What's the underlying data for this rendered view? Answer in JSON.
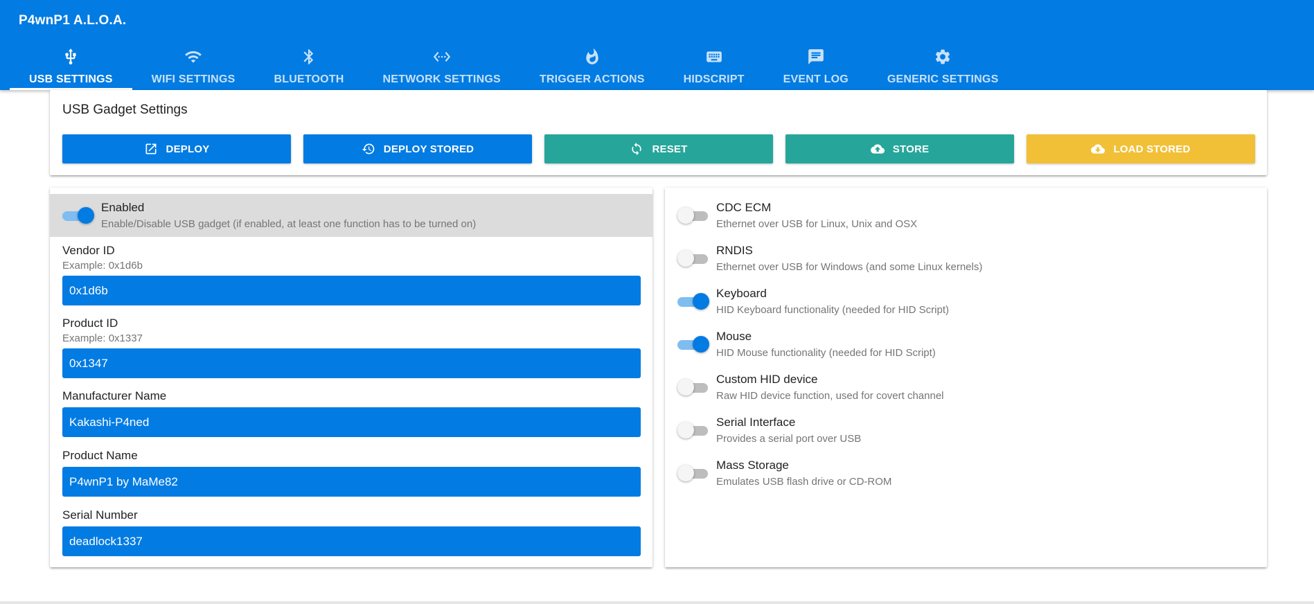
{
  "app": {
    "title": "P4wnP1 A.L.O.A."
  },
  "tabs": [
    {
      "label": "USB SETTINGS",
      "icon": "usb-icon",
      "active": true
    },
    {
      "label": "WIFI SETTINGS",
      "icon": "wifi-icon"
    },
    {
      "label": "BLUETOOTH",
      "icon": "bluetooth-icon"
    },
    {
      "label": "NETWORK SETTINGS",
      "icon": "network-icon"
    },
    {
      "label": "TRIGGER ACTIONS",
      "icon": "flame-icon"
    },
    {
      "label": "HIDSCRIPT",
      "icon": "keyboard-icon"
    },
    {
      "label": "EVENT LOG",
      "icon": "message-icon"
    },
    {
      "label": "GENERIC SETTINGS",
      "icon": "gear-icon"
    }
  ],
  "gadget": {
    "title": "USB Gadget Settings",
    "buttons": [
      {
        "label": "DEPLOY",
        "icon": "open-in-new-icon",
        "color": "#027be3"
      },
      {
        "label": "DEPLOY STORED",
        "icon": "restore-icon",
        "color": "#027be3"
      },
      {
        "label": "RESET",
        "icon": "refresh-icon",
        "color": "#26a69a"
      },
      {
        "label": "STORE",
        "icon": "cloud-upload-icon",
        "color": "#26a69a"
      },
      {
        "label": "LOAD STORED",
        "icon": "cloud-download-icon",
        "color": "#f2c037"
      }
    ]
  },
  "left": {
    "enabled": {
      "title": "Enabled",
      "desc": "Enable/Disable USB gadget (if enabled, at least one function has to be turned on)",
      "on": true
    },
    "vendor": {
      "label": "Vendor ID",
      "hint": "Example: 0x1d6b",
      "value": "0x1d6b"
    },
    "product": {
      "label": "Product ID",
      "hint": "Example: 0x1337",
      "value": "0x1347"
    },
    "manufacturer": {
      "label": "Manufacturer Name",
      "value": "Kakashi-P4ned"
    },
    "product_name": {
      "label": "Product Name",
      "value": "P4wnP1 by MaMe82"
    },
    "serial": {
      "label": "Serial Number",
      "value": "deadlock1337"
    }
  },
  "functions": [
    {
      "title": "CDC ECM",
      "desc": "Ethernet over USB for Linux, Unix and OSX",
      "on": false
    },
    {
      "title": "RNDIS",
      "desc": "Ethernet over USB for Windows (and some Linux kernels)",
      "on": false
    },
    {
      "title": "Keyboard",
      "desc": "HID Keyboard functionality (needed for HID Script)",
      "on": true
    },
    {
      "title": "Mouse",
      "desc": "HID Mouse functionality (needed for HID Script)",
      "on": true
    },
    {
      "title": "Custom HID device",
      "desc": "Raw HID device function, used for covert channel",
      "on": false
    },
    {
      "title": "Serial Interface",
      "desc": "Provides a serial port over USB",
      "on": false
    },
    {
      "title": "Mass Storage",
      "desc": "Emulates USB flash drive or CD-ROM",
      "on": false
    }
  ]
}
